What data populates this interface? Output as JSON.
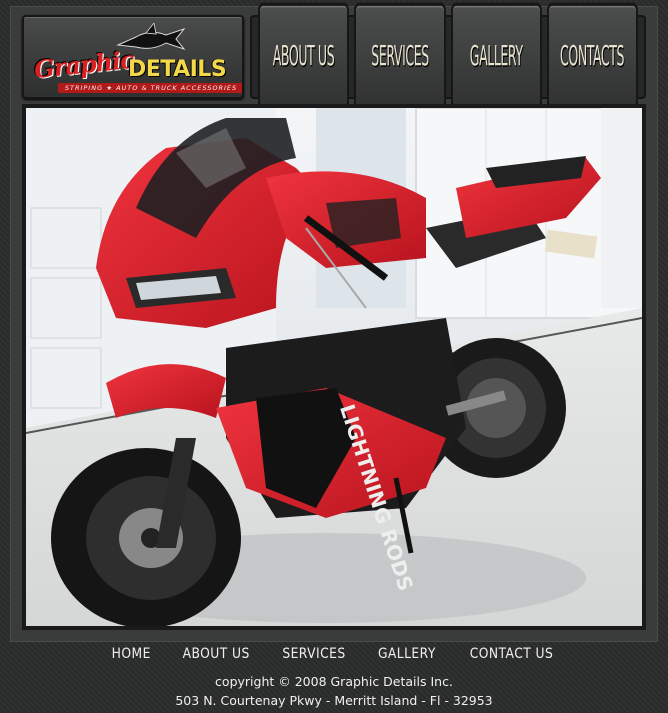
{
  "logo": {
    "brand_part1": "Graphic",
    "brand_part2": "DETAILS",
    "tagline": "STRIPING ★ AUTO & TRUCK ACCESSORIES"
  },
  "nav": {
    "items": [
      {
        "label": "ABOUT US"
      },
      {
        "label": "SERVICES"
      },
      {
        "label": "GALLERY"
      },
      {
        "label": "CONTACTS"
      }
    ]
  },
  "hero": {
    "fairing_text": "LIGHTNING RODS"
  },
  "footer": {
    "links": [
      {
        "label": "HOME"
      },
      {
        "label": "ABOUT US"
      },
      {
        "label": "SERVICES"
      },
      {
        "label": "GALLERY"
      },
      {
        "label": "CONTACT US"
      }
    ],
    "copyright": "copyright © 2008 Graphic Details Inc.",
    "address": "503 N. Courtenay Pkwy - Merritt Island - Fl - 32953"
  },
  "colors": {
    "background": "#2b2c2c",
    "accent_red": "#d92121",
    "accent_yellow": "#f3d84a",
    "nav_text": "#e8e3cf"
  }
}
